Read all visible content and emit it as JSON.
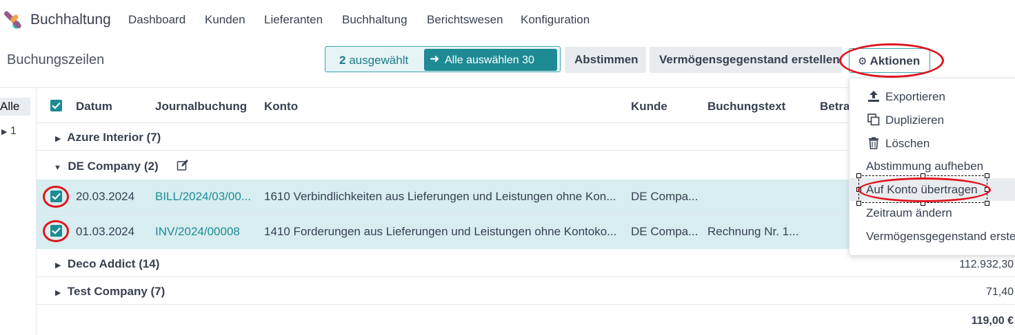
{
  "app": {
    "name": "Buchhaltung",
    "nav": [
      "Dashboard",
      "Kunden",
      "Lieferanten",
      "Buchhaltung",
      "Berichtswesen",
      "Konfiguration"
    ]
  },
  "page": {
    "title": "Buchungszeilen"
  },
  "selection": {
    "count": "2",
    "count_suffix": "ausgewählt",
    "select_all_label": "Alle auswählen 30"
  },
  "toolbar": {
    "reconcile": "Abstimmen",
    "create_asset": "Vermögensgegenstand erstellen",
    "actions": "Aktionen"
  },
  "sidebar": {
    "all": "Alle",
    "item": "1"
  },
  "table": {
    "headers": [
      "Datum",
      "Journalbuchung",
      "Konto",
      "Kunde",
      "Buchungstext",
      "Betra"
    ],
    "groups": [
      {
        "label": "Azure Interior (7)",
        "total": ""
      },
      {
        "label": "DE Company (2)",
        "total": ""
      },
      {
        "label": "Deco Addict (14)",
        "total": "112.932,30"
      },
      {
        "label": "Test Company (7)",
        "total": "71,40"
      }
    ],
    "rows": [
      {
        "date": "20.03.2024",
        "entry": "BILL/2024/03/00...",
        "account": "1610 Verbindlichkeiten aus Lieferungen und Leistungen ohne Kon...",
        "partner": "DE Compa...",
        "label": ""
      },
      {
        "date": "01.03.2024",
        "entry": "INV/2024/00008",
        "account": "1410 Forderungen aus Lieferungen und Leistungen ohne Kontoko...",
        "partner": "DE Compa...",
        "label": "Rechnung Nr. 1..."
      }
    ],
    "footer_total": "119,00 €"
  },
  "actions_menu": {
    "items": [
      "Exportieren",
      "Duplizieren",
      "Löschen",
      "Abstimmung aufheben",
      "Auf Konto übertragen",
      "Zeitraum ändern",
      "Vermögensgegenstand erste"
    ]
  },
  "colors": {
    "accent": "#1e8b94",
    "selected_row": "#d7edf0",
    "annotation": "#e0141e"
  }
}
